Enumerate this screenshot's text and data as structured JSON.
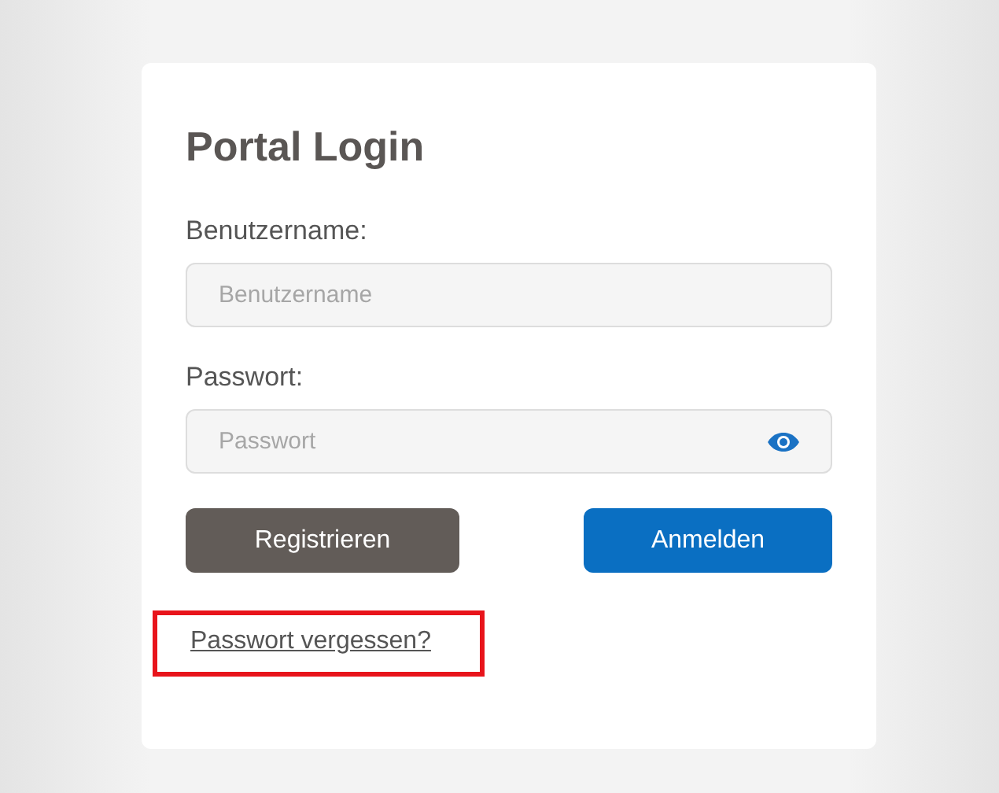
{
  "title": "Portal Login",
  "fields": [
    {
      "label": "Benutzername:",
      "placeholder": "Benutzername",
      "kind": "text"
    },
    {
      "label": "Passwort:",
      "placeholder": "Passwort",
      "kind": "password"
    }
  ],
  "buttons": [
    {
      "label": "Registrieren",
      "kind": "secondary"
    },
    {
      "label": "Anmelden",
      "kind": "primary"
    }
  ],
  "forgot_link": {
    "label": "Passwort vergessen?",
    "highlighted": true
  }
}
